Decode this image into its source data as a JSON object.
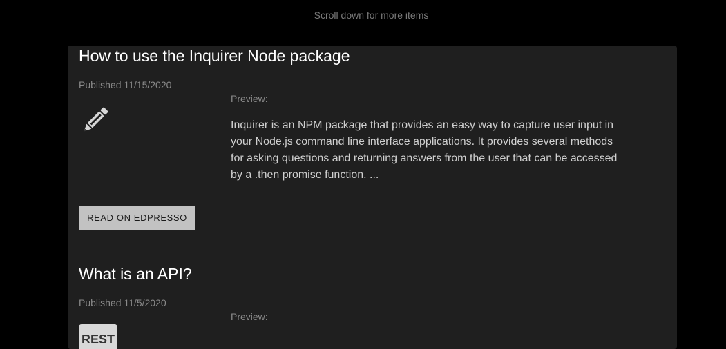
{
  "scroll_hint": "Scroll down for more items",
  "articles": [
    {
      "title": "How to use the Inquirer Node package",
      "published": "Published 11/15/2020",
      "preview_label": "Preview:",
      "preview_text": "Inquirer is an NPM package that provides an easy way to capture user input in your Node.js command line interface applications. It provides several methods for asking questions and returning answers from the user that can be accessed by a .then promise function. ...",
      "icon": "pencil-icon",
      "button_label": "READ ON EDPRESSO"
    },
    {
      "title": "What is an API?",
      "published": "Published 11/5/2020",
      "preview_label": "Preview:",
      "icon": "rest-api-icon",
      "icon_text": "REST"
    }
  ]
}
